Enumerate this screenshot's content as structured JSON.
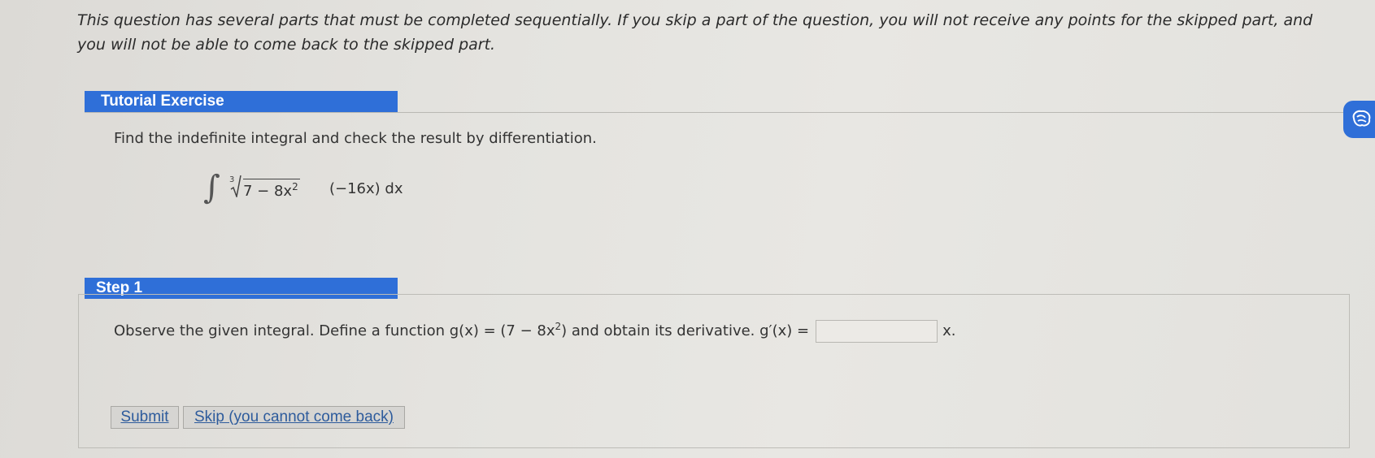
{
  "intro": {
    "text": "This question has several parts that must be completed sequentially. If you skip a part of the question, you will not receive any points for the skipped part, and you will not be able to come back to the skipped part."
  },
  "tutorial": {
    "title": "Tutorial Exercise",
    "instruction": "Find the indefinite integral and check the result by differentiation.",
    "integral": {
      "index": "3",
      "radicand_base": "7 − 8x",
      "radicand_exp": "2",
      "tail": "(−16x) dx"
    }
  },
  "step1": {
    "title": "Step 1",
    "text_before": "Observe the given integral. Define a function g(x) = (7 − 8x",
    "text_exp": "2",
    "text_after": ") and obtain its derivative. g′(x) =",
    "answer_value": "",
    "answer_suffix": "x."
  },
  "buttons": {
    "submit": "Submit",
    "skip": "Skip (you cannot come back)"
  },
  "side_widget": {
    "icon": "brain-icon",
    "color": "#2f6fd8"
  }
}
